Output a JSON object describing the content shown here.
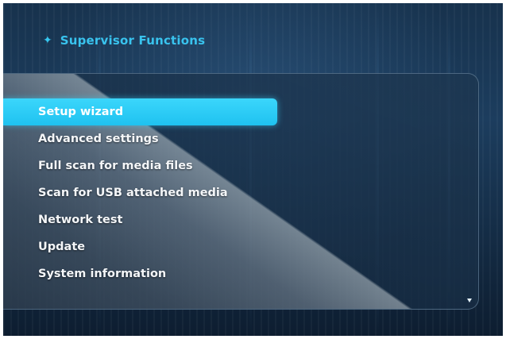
{
  "header": {
    "icon": "diamond-bullet-icon",
    "title": "Supervisor Functions"
  },
  "menu": {
    "selected_index": 0,
    "items": [
      {
        "label": "Setup wizard"
      },
      {
        "label": "Advanced settings"
      },
      {
        "label": "Full scan for media files"
      },
      {
        "label": "Scan for USB attached media"
      },
      {
        "label": "Network test"
      },
      {
        "label": "Update"
      },
      {
        "label": "System information"
      }
    ],
    "scroll_icon": "scroll-down-arrow-icon"
  },
  "colors": {
    "accent": "#2ec9f4",
    "header_text": "#39c3ee",
    "menu_text": "#f4f6f8",
    "background": "#1c3d5e"
  }
}
